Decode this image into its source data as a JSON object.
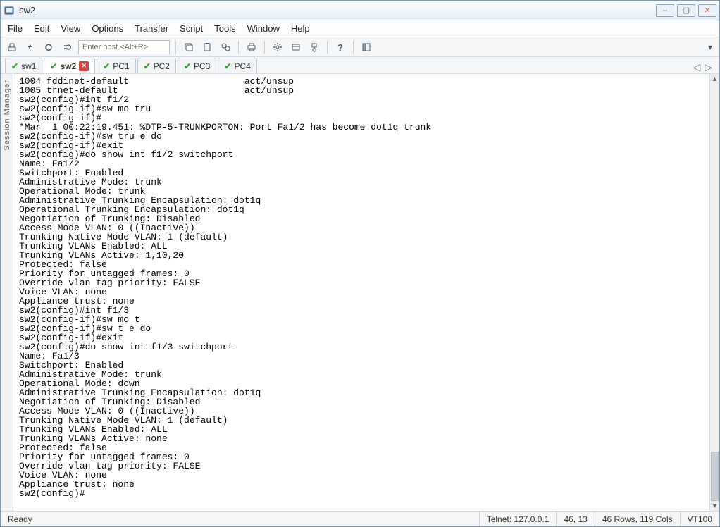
{
  "window": {
    "title": "sw2",
    "controls": {
      "min": "–",
      "max": "▢",
      "close": "✕"
    }
  },
  "menu": [
    "File",
    "Edit",
    "View",
    "Options",
    "Transfer",
    "Script",
    "Tools",
    "Window",
    "Help"
  ],
  "toolbar": {
    "host_placeholder": "Enter host <Alt+R>"
  },
  "tabs": [
    {
      "label": "sw1",
      "active": false,
      "closable": false
    },
    {
      "label": "sw2",
      "active": true,
      "closable": true
    },
    {
      "label": "PC1",
      "active": false,
      "closable": false
    },
    {
      "label": "PC2",
      "active": false,
      "closable": false
    },
    {
      "label": "PC3",
      "active": false,
      "closable": false
    },
    {
      "label": "PC4",
      "active": false,
      "closable": false
    }
  ],
  "sidebar": {
    "label": "Session Manager"
  },
  "terminal_text": "1004 fddinet-default                     act/unsup\n1005 trnet-default                       act/unsup\nsw2(config)#int f1/2\nsw2(config-if)#sw mo tru\nsw2(config-if)#\n*Mar  1 00:22:19.451: %DTP-5-TRUNKPORTON: Port Fa1/2 has become dot1q trunk\nsw2(config-if)#sw tru e do\nsw2(config-if)#exit\nsw2(config)#do show int f1/2 switchport\nName: Fa1/2\nSwitchport: Enabled\nAdministrative Mode: trunk\nOperational Mode: trunk\nAdministrative Trunking Encapsulation: dot1q\nOperational Trunking Encapsulation: dot1q\nNegotiation of Trunking: Disabled\nAccess Mode VLAN: 0 ((Inactive))\nTrunking Native Mode VLAN: 1 (default)\nTrunking VLANs Enabled: ALL\nTrunking VLANs Active: 1,10,20\nProtected: false\nPriority for untagged frames: 0\nOverride vlan tag priority: FALSE\nVoice VLAN: none\nAppliance trust: none\nsw2(config)#int f1/3\nsw2(config-if)#sw mo t\nsw2(config-if)#sw t e do\nsw2(config-if)#exit\nsw2(config)#do show int f1/3 switchport\nName: Fa1/3\nSwitchport: Enabled\nAdministrative Mode: trunk\nOperational Mode: down\nAdministrative Trunking Encapsulation: dot1q\nNegotiation of Trunking: Disabled\nAccess Mode VLAN: 0 ((Inactive))\nTrunking Native Mode VLAN: 1 (default)\nTrunking VLANs Enabled: ALL\nTrunking VLANs Active: none\nProtected: false\nPriority for untagged frames: 0\nOverride vlan tag priority: FALSE\nVoice VLAN: none\nAppliance trust: none\nsw2(config)#",
  "status": {
    "ready": "Ready",
    "conn": "Telnet: 127.0.0.1",
    "pos": "46,  13",
    "dims": "46 Rows, 119 Cols",
    "term": "VT100"
  }
}
